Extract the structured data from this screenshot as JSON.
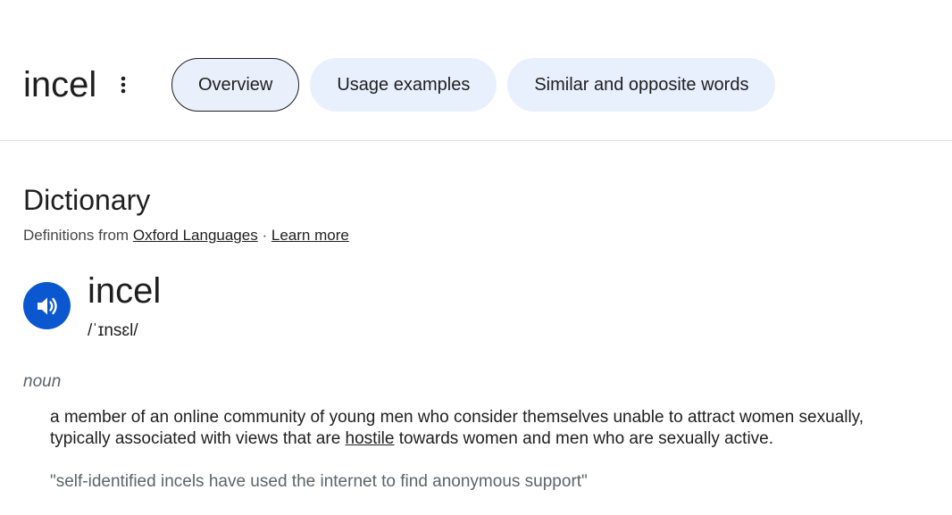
{
  "header": {
    "term": "incel",
    "tabs": [
      {
        "label": "Overview",
        "active": true
      },
      {
        "label": "Usage examples",
        "active": false
      },
      {
        "label": "Similar and opposite words",
        "active": false
      }
    ]
  },
  "dictionary": {
    "title": "Dictionary",
    "source_prefix": "Definitions from",
    "source_link": "Oxford Languages",
    "separator": "·",
    "learn_more": "Learn more",
    "headword": "incel",
    "phonetic": "/ˈɪnsɛl/",
    "part_of_speech": "noun",
    "definition": {
      "before": "a member of an online community of young men who consider themselves unable to attract women sexually, typically associated with views that are ",
      "link": "hostile",
      "after": " towards women and men who are sexually active."
    },
    "example": "\"self-identified incels have used the internet to find anonymous support\""
  },
  "icons": {
    "more": "more-vert-icon",
    "audio": "speaker-icon"
  },
  "colors": {
    "accent": "#0b57d0",
    "tab_bg": "#e8effd",
    "divider": "#dadce0"
  }
}
